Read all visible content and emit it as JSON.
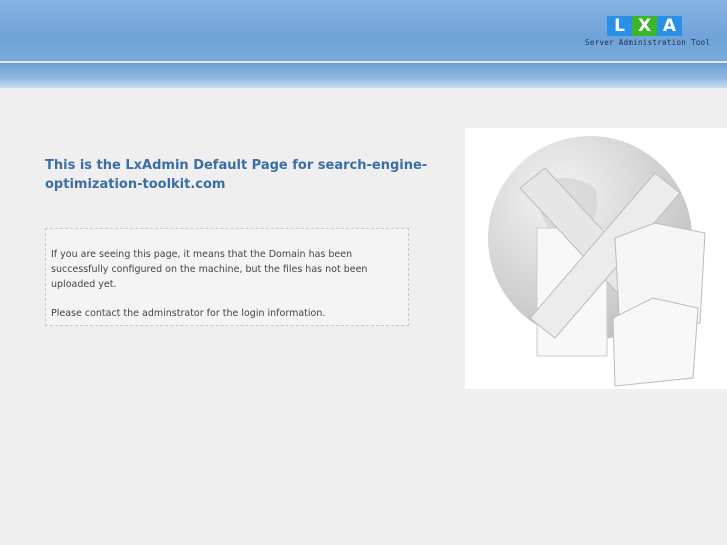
{
  "header": {
    "logo_letters": [
      "L",
      "X",
      "A"
    ],
    "tagline": "Server Administration Tool"
  },
  "main": {
    "title": "This is the LxAdmin Default Page for search-engine-optimization-toolkit.com",
    "message_1": "If you are seeing this page, it means that the Domain has been successfully configured on the machine, but the files has not been uploaded yet.",
    "message_2": "Please contact the adminstrator for the login information."
  },
  "colors": {
    "title": "#3a6ea5",
    "background": "#efefef",
    "header": "#6fa3d8"
  }
}
